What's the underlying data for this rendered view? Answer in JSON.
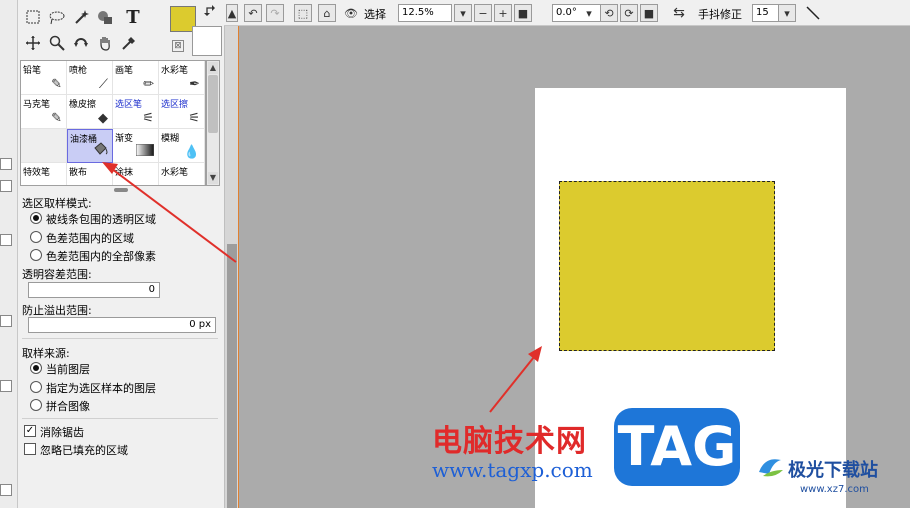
{
  "toolbar": {
    "select_label": "选择",
    "zoom_value": "12.5%",
    "rotation_value": "0.0°",
    "stabilizer_label": "手抖修正",
    "stabilizer_value": "15"
  },
  "tools": {
    "text_tool_glyph": "T",
    "primary_color": "#dccb2e"
  },
  "brushes": [
    {
      "label": "铅笔",
      "icon": "pencil-icon"
    },
    {
      "label": "喷枪",
      "icon": "airbrush-icon"
    },
    {
      "label": "画笔",
      "icon": "brush-icon"
    },
    {
      "label": "水彩笔",
      "icon": "watercolor-icon"
    },
    {
      "label": "马克笔",
      "icon": "marker-icon"
    },
    {
      "label": "橡皮擦",
      "icon": "eraser-icon"
    },
    {
      "label": "选区笔",
      "icon": "select-pen-icon"
    },
    {
      "label": "选区擦",
      "icon": "select-eraser-icon"
    },
    {
      "label": "",
      "icon": ""
    },
    {
      "label": "油漆桶",
      "icon": "bucket-icon"
    },
    {
      "label": "渐变",
      "icon": "gradient-icon"
    },
    {
      "label": "模糊",
      "icon": "blur-icon"
    },
    {
      "label": "特效笔",
      "icon": "fx-pen-icon"
    },
    {
      "label": "散布",
      "icon": "scatter-icon"
    },
    {
      "label": "涂抹",
      "icon": "smudge-icon"
    },
    {
      "label": "水彩笔",
      "icon": "watercolor-icon"
    }
  ],
  "options": {
    "sampling_mode_label": "选区取样模式:",
    "sampling_modes": [
      "被线条包围的透明区域",
      "色差范围内的区域",
      "色差范围内的全部像素"
    ],
    "transparency_tolerance_label": "透明容差范围:",
    "transparency_tolerance_value": "0",
    "overflow_prevention_label": "防止溢出范围:",
    "overflow_prevention_value": "0 px",
    "sample_source_label": "取样来源:",
    "sample_sources": [
      "当前图层",
      "指定为选区样本的图层",
      "拼合图像"
    ],
    "antialias_label": "消除锯齿",
    "ignore_filled_label": "忽略已填充的区域"
  },
  "watermark": {
    "title": "电脑技术网",
    "url": "www.tagxp.com",
    "tag": "TAG",
    "site_name": "极光下载站",
    "site_url": "www.xz7.com"
  }
}
